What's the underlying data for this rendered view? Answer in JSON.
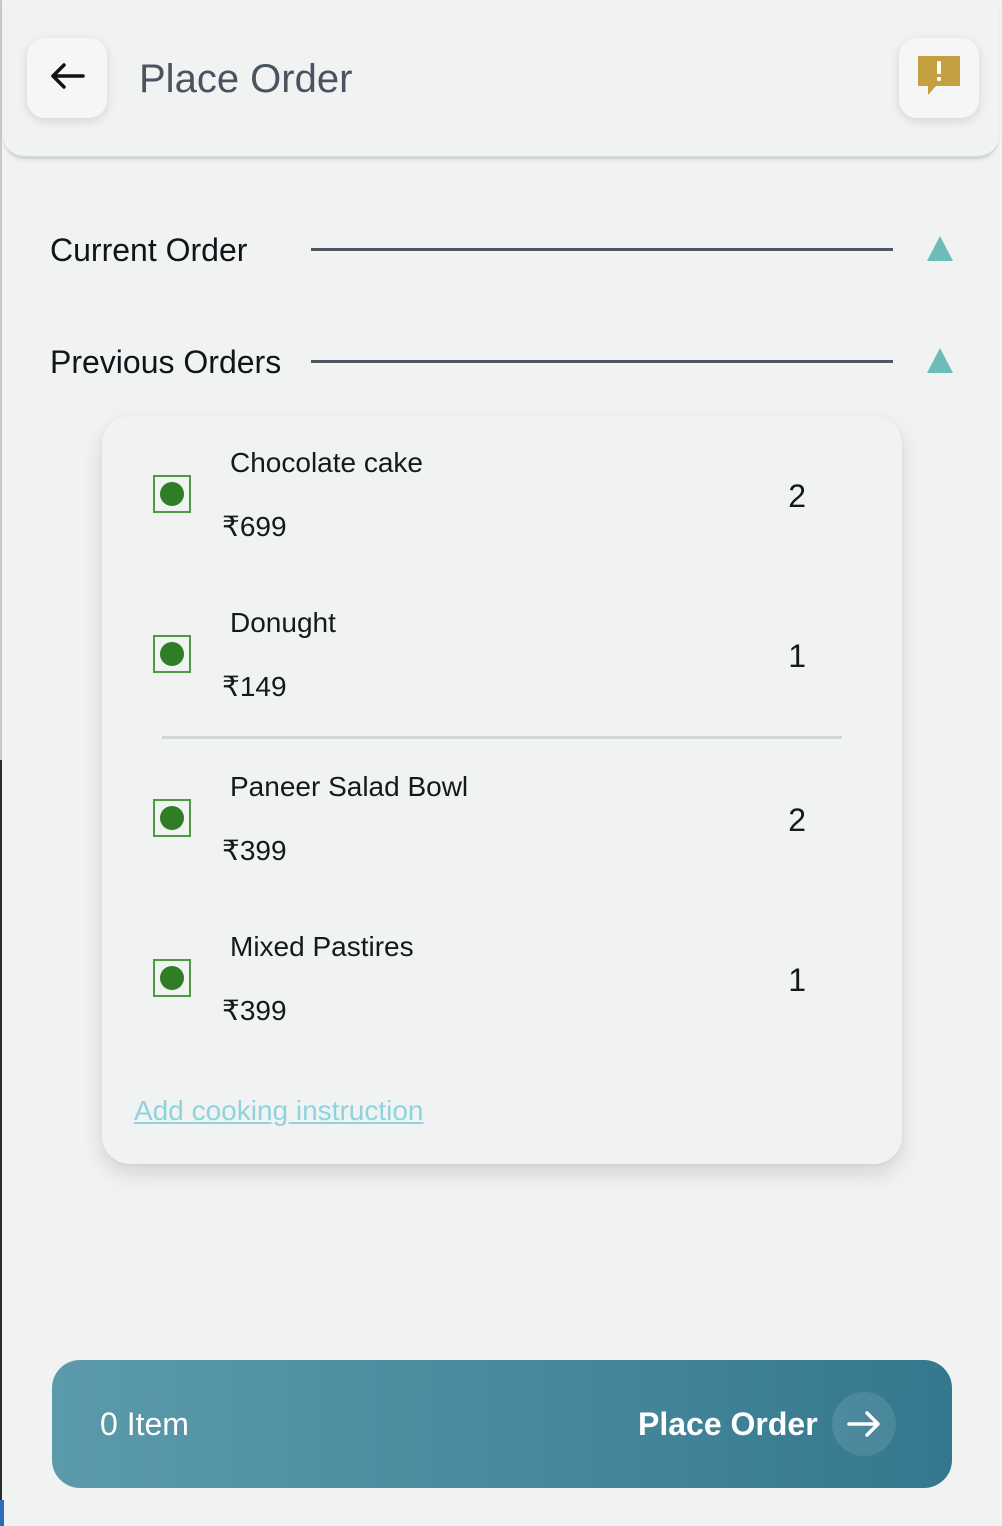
{
  "header": {
    "title": "Place Order",
    "back_icon": "arrow-left-icon",
    "feedback_icon": "alert-message-icon"
  },
  "sections": {
    "current": {
      "label": "Current Order"
    },
    "previous": {
      "label": "Previous Orders"
    }
  },
  "items": [
    {
      "name": "Chocolate cake",
      "price": "₹699",
      "qty": "2"
    },
    {
      "name": "Donught",
      "price": "₹149",
      "qty": "1"
    },
    {
      "name": "Paneer Salad Bowl",
      "price": "₹399",
      "qty": "2"
    },
    {
      "name": "Mixed Pastires",
      "price": "₹399",
      "qty": "1"
    }
  ],
  "cooking_instruction": "Add cooking instruction",
  "bottom_bar": {
    "count": "0 Item",
    "action": "Place Order"
  },
  "colors": {
    "accent_teal": "#6cbdb8",
    "veg_green": "#2f7d24",
    "feedback_gold": "#c4a040",
    "link": "#8fd3de",
    "bar_start": "#5b9aaa",
    "bar_end": "#33788e"
  }
}
